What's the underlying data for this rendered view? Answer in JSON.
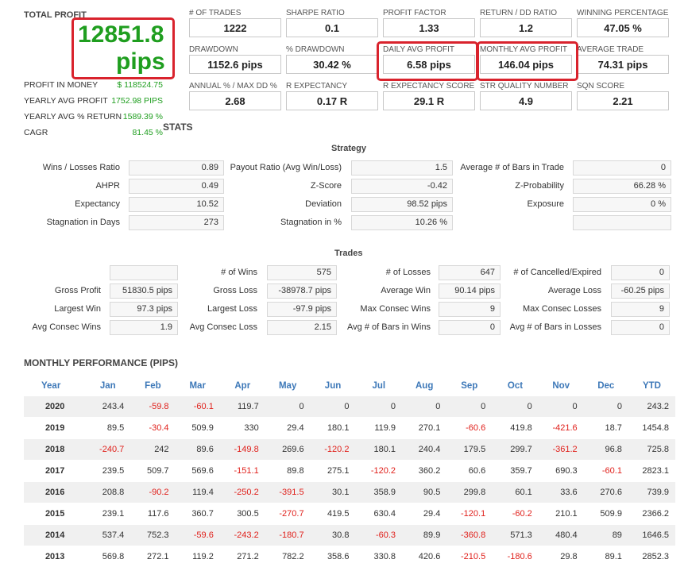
{
  "summary": {
    "total_profit_label": "TOTAL PROFIT",
    "total_profit_value": "12851.8",
    "total_profit_unit": "pips",
    "left_rows": [
      {
        "label": "PROFIT IN MONEY",
        "value": "$ 118524.75"
      },
      {
        "label": "YEARLY AVG PROFIT",
        "value": "1752.98 PIPS"
      },
      {
        "label": "YEARLY AVG % RETURN",
        "value": "1589.39 %"
      },
      {
        "label": "CAGR",
        "value": "81.45 %"
      }
    ],
    "stats_label": "STATS"
  },
  "metrics": [
    {
      "label": "# OF TRADES",
      "value": "1222"
    },
    {
      "label": "SHARPE RATIO",
      "value": "0.1"
    },
    {
      "label": "PROFIT FACTOR",
      "value": "1.33"
    },
    {
      "label": "RETURN / DD RATIO",
      "value": "1.2"
    },
    {
      "label": "WINNING PERCENTAGE",
      "value": "47.05 %"
    },
    {
      "label": "DRAWDOWN",
      "value": "1152.6 pips"
    },
    {
      "label": "% DRAWDOWN",
      "value": "30.42 %"
    },
    {
      "label": "DAILY AVG PROFIT",
      "value": "6.58 pips"
    },
    {
      "label": "MONTHLY AVG PROFIT",
      "value": "146.04 pips"
    },
    {
      "label": "AVERAGE TRADE",
      "value": "74.31 pips"
    },
    {
      "label": "ANNUAL % / MAX DD %",
      "value": "2.68"
    },
    {
      "label": "R EXPECTANCY",
      "value": "0.17 R"
    },
    {
      "label": "R EXPECTANCY SCORE",
      "value": "29.1 R"
    },
    {
      "label": "STR QUALITY NUMBER",
      "value": "4.9"
    },
    {
      "label": "SQN SCORE",
      "value": "2.21"
    }
  ],
  "strategy": {
    "title": "Strategy",
    "rows": [
      [
        {
          "label": "Wins / Losses Ratio",
          "value": "0.89"
        },
        {
          "label": "Payout Ratio (Avg Win/Loss)",
          "value": "1.5"
        },
        {
          "label": "Average # of Bars in Trade",
          "value": "0"
        }
      ],
      [
        {
          "label": "AHPR",
          "value": "0.49"
        },
        {
          "label": "Z-Score",
          "value": "-0.42"
        },
        {
          "label": "Z-Probability",
          "value": "66.28 %"
        }
      ],
      [
        {
          "label": "Expectancy",
          "value": "10.52"
        },
        {
          "label": "Deviation",
          "value": "98.52 pips"
        },
        {
          "label": "Exposure",
          "value": "0 %"
        }
      ],
      [
        {
          "label": "Stagnation in Days",
          "value": "273"
        },
        {
          "label": "Stagnation in %",
          "value": "10.26 %"
        },
        {
          "label": "",
          "value": ""
        }
      ]
    ]
  },
  "trades": {
    "title": "Trades",
    "rows": [
      [
        {
          "label": "",
          "value": ""
        },
        {
          "label": "# of Wins",
          "value": "575"
        },
        {
          "label": "# of Losses",
          "value": "647"
        },
        {
          "label": "# of Cancelled/Expired",
          "value": "0"
        }
      ],
      [
        {
          "label": "Gross Profit",
          "value": "51830.5 pips"
        },
        {
          "label": "Gross Loss",
          "value": "-38978.7 pips"
        },
        {
          "label": "Average Win",
          "value": "90.14 pips"
        },
        {
          "label": "Average Loss",
          "value": "-60.25 pips"
        }
      ],
      [
        {
          "label": "Largest Win",
          "value": "97.3 pips"
        },
        {
          "label": "Largest Loss",
          "value": "-97.9 pips"
        },
        {
          "label": "Max Consec Wins",
          "value": "9"
        },
        {
          "label": "Max Consec Losses",
          "value": "9"
        }
      ],
      [
        {
          "label": "Avg Consec Wins",
          "value": "1.9"
        },
        {
          "label": "Avg Consec Loss",
          "value": "2.15"
        },
        {
          "label": "Avg # of Bars in Wins",
          "value": "0"
        },
        {
          "label": "Avg # of Bars in Losses",
          "value": "0"
        }
      ]
    ]
  },
  "monthly": {
    "title": "MONTHLY PERFORMANCE (PIPS)",
    "columns": [
      "Year",
      "Jan",
      "Feb",
      "Mar",
      "Apr",
      "May",
      "Jun",
      "Jul",
      "Aug",
      "Sep",
      "Oct",
      "Nov",
      "Dec",
      "YTD"
    ],
    "rows": [
      [
        "2020",
        "243.4",
        "-59.8",
        "-60.1",
        "119.7",
        "0",
        "0",
        "0",
        "0",
        "0",
        "0",
        "0",
        "0",
        "243.2"
      ],
      [
        "2019",
        "89.5",
        "-30.4",
        "509.9",
        "330",
        "29.4",
        "180.1",
        "119.9",
        "270.1",
        "-60.6",
        "419.8",
        "-421.6",
        "18.7",
        "1454.8"
      ],
      [
        "2018",
        "-240.7",
        "242",
        "89.6",
        "-149.8",
        "269.6",
        "-120.2",
        "180.1",
        "240.4",
        "179.5",
        "299.7",
        "-361.2",
        "96.8",
        "725.8"
      ],
      [
        "2017",
        "239.5",
        "509.7",
        "569.6",
        "-151.1",
        "89.8",
        "275.1",
        "-120.2",
        "360.2",
        "60.6",
        "359.7",
        "690.3",
        "-60.1",
        "2823.1"
      ],
      [
        "2016",
        "208.8",
        "-90.2",
        "119.4",
        "-250.2",
        "-391.5",
        "30.1",
        "358.9",
        "90.5",
        "299.8",
        "60.1",
        "33.6",
        "270.6",
        "739.9"
      ],
      [
        "2015",
        "239.1",
        "117.6",
        "360.7",
        "300.5",
        "-270.7",
        "419.5",
        "630.4",
        "29.4",
        "-120.1",
        "-60.2",
        "210.1",
        "509.9",
        "2366.2"
      ],
      [
        "2014",
        "537.4",
        "752.3",
        "-59.6",
        "-243.2",
        "-180.7",
        "30.8",
        "-60.3",
        "89.9",
        "-360.8",
        "571.3",
        "480.4",
        "89",
        "1646.5"
      ],
      [
        "2013",
        "569.8",
        "272.1",
        "119.2",
        "271.2",
        "782.2",
        "358.6",
        "330.8",
        "420.6",
        "-210.5",
        "-180.6",
        "29.8",
        "89.1",
        "2852.3"
      ]
    ]
  },
  "colors": {
    "accent_green": "#1f9e1f",
    "negative_red": "#e0201b",
    "highlight_red": "#d9232d",
    "header_blue": "#3d78b8"
  }
}
